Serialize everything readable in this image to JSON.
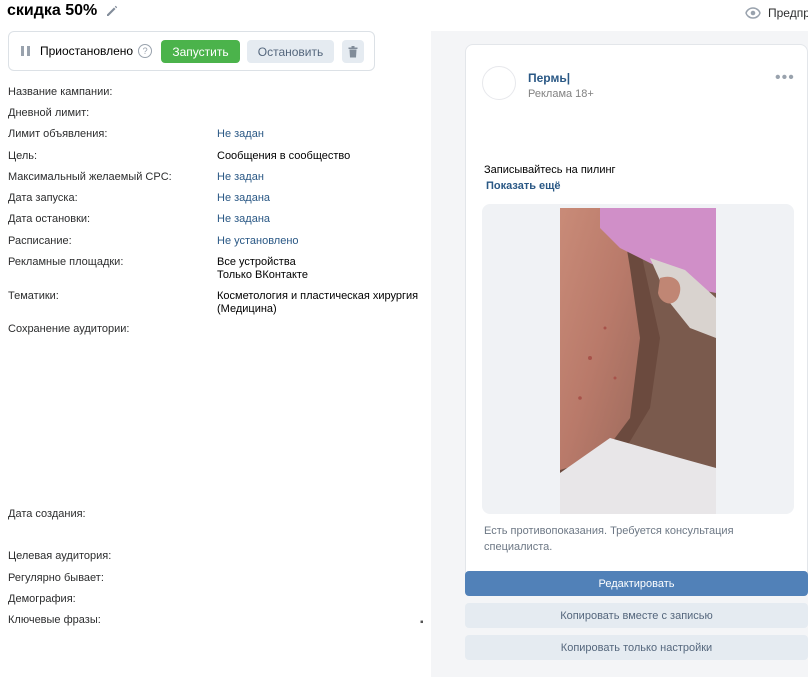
{
  "header": {
    "title": "скидка 50%",
    "preview_label": "Предпр"
  },
  "status": {
    "text": "Приостановлено",
    "help": "?",
    "start_label": "Запустить",
    "stop_label": "Остановить"
  },
  "props": [
    {
      "label": "Название кампании:",
      "value": ""
    },
    {
      "label": "Дневной лимит:",
      "value": ""
    },
    {
      "label": "Лимит объявления:",
      "value": "Не задан"
    },
    {
      "label": "Цель:",
      "value": "Сообщения в сообщество"
    },
    {
      "label": "Максимальный желаемый CPC:",
      "value": "Не задан"
    },
    {
      "label": "Дата запуска:",
      "value": "Не задана"
    },
    {
      "label": "Дата остановки:",
      "value": "Не задана"
    },
    {
      "label": "Расписание:",
      "value": "Не установлено"
    },
    {
      "label": "Рекламные площадки:",
      "value": "Все устройства",
      "value2": "Только ВКонтакте"
    },
    {
      "label": "Тематики:",
      "value": "Косметология и пластическая хирургия",
      "value2": "(Медицина)"
    },
    {
      "label": "Сохранение аудитории:",
      "value": ""
    },
    {
      "label": "Дата создания:",
      "value": ""
    },
    {
      "label": "Целевая аудитория:",
      "value": ""
    },
    {
      "label": "Регулярно бывает:",
      "value": ""
    },
    {
      "label": "Демография:",
      "value": ""
    },
    {
      "label": "Ключевые фразы:",
      "value": ""
    }
  ],
  "post": {
    "group_name": "Пермь|",
    "ad_label": "Реклама 18+",
    "more": "•••",
    "text": "Записывайтесь на пилинг",
    "show_more": "Показать ещё",
    "disclaimer": "Есть противопоказания. Требуется консультация специалиста."
  },
  "actions": {
    "edit": "Редактировать",
    "copy_with_post": "Копировать вместе с записью",
    "copy_settings": "Копировать только настройки"
  },
  "colors": {
    "accent": "#5181b8",
    "start_green": "#4bb34b",
    "link_blue": "#2a5885"
  }
}
